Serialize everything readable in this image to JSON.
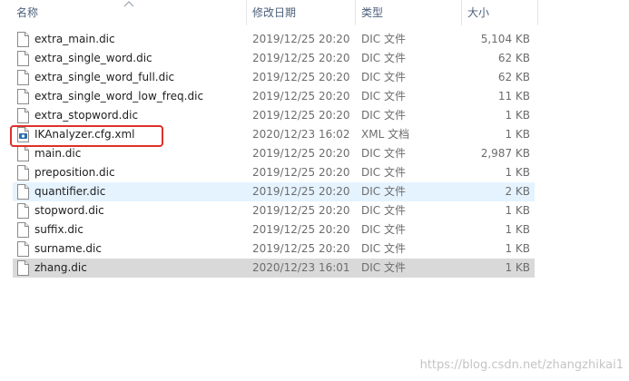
{
  "columns": {
    "name": "名称",
    "date": "修改日期",
    "type": "类型",
    "size": "大小"
  },
  "sort_indicator_icon": "chevron-up-icon",
  "files": [
    {
      "name": "extra_main.dic",
      "date": "2019/12/25 20:20",
      "type": "DIC 文件",
      "size": "5,104 KB",
      "icon": "file-icon"
    },
    {
      "name": "extra_single_word.dic",
      "date": "2019/12/25 20:20",
      "type": "DIC 文件",
      "size": "62 KB",
      "icon": "file-icon"
    },
    {
      "name": "extra_single_word_full.dic",
      "date": "2019/12/25 20:20",
      "type": "DIC 文件",
      "size": "62 KB",
      "icon": "file-icon"
    },
    {
      "name": "extra_single_word_low_freq.dic",
      "date": "2019/12/25 20:20",
      "type": "DIC 文件",
      "size": "11 KB",
      "icon": "file-icon"
    },
    {
      "name": "extra_stopword.dic",
      "date": "2019/12/25 20:20",
      "type": "DIC 文件",
      "size": "1 KB",
      "icon": "file-icon"
    },
    {
      "name": "IKAnalyzer.cfg.xml",
      "date": "2020/12/23 16:02",
      "type": "XML 文档",
      "size": "1 KB",
      "icon": "xml-file-icon",
      "highlighted": true
    },
    {
      "name": "main.dic",
      "date": "2019/12/25 20:20",
      "type": "DIC 文件",
      "size": "2,987 KB",
      "icon": "file-icon"
    },
    {
      "name": "preposition.dic",
      "date": "2019/12/25 20:20",
      "type": "DIC 文件",
      "size": "1 KB",
      "icon": "file-icon"
    },
    {
      "name": "quantifier.dic",
      "date": "2019/12/25 20:20",
      "type": "DIC 文件",
      "size": "2 KB",
      "icon": "file-icon",
      "state": "hover"
    },
    {
      "name": "stopword.dic",
      "date": "2019/12/25 20:20",
      "type": "DIC 文件",
      "size": "1 KB",
      "icon": "file-icon"
    },
    {
      "name": "suffix.dic",
      "date": "2019/12/25 20:20",
      "type": "DIC 文件",
      "size": "1 KB",
      "icon": "file-icon"
    },
    {
      "name": "surname.dic",
      "date": "2019/12/25 20:20",
      "type": "DIC 文件",
      "size": "1 KB",
      "icon": "file-icon"
    },
    {
      "name": "zhang.dic",
      "date": "2020/12/23 16:01",
      "type": "DIC 文件",
      "size": "1 KB",
      "icon": "file-icon",
      "state": "selected"
    }
  ],
  "watermark": "https://blog.csdn.net/zhangzhikai1",
  "colors": {
    "hover_row": "#e5f3ff",
    "selected_row": "#d9d9d9",
    "highlight_border": "#e0302a",
    "header_text": "#4c607a"
  }
}
